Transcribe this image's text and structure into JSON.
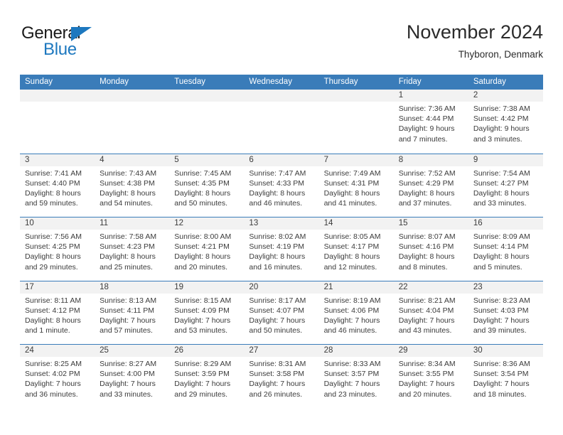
{
  "brand": {
    "name_part1": "General",
    "name_part2": "Blue",
    "triangle_color": "#1d78bf",
    "text_color": "#1a1a1a"
  },
  "header": {
    "title": "November 2024",
    "subtitle": "Thyboron, Denmark"
  },
  "theme": {
    "header_blue": "#3a7cb9",
    "date_strip_gray": "#f2f2f2",
    "text_color": "#3b3b3b",
    "background": "#ffffff"
  },
  "weekdays": [
    "Sunday",
    "Monday",
    "Tuesday",
    "Wednesday",
    "Thursday",
    "Friday",
    "Saturday"
  ],
  "weeks": [
    [
      {
        "blank": true
      },
      {
        "blank": true
      },
      {
        "blank": true
      },
      {
        "blank": true
      },
      {
        "blank": true
      },
      {
        "blank": false,
        "day": "1",
        "sunrise": "Sunrise: 7:36 AM",
        "sunset": "Sunset: 4:44 PM",
        "daylight1": "Daylight: 9 hours",
        "daylight2": "and 7 minutes."
      },
      {
        "blank": false,
        "day": "2",
        "sunrise": "Sunrise: 7:38 AM",
        "sunset": "Sunset: 4:42 PM",
        "daylight1": "Daylight: 9 hours",
        "daylight2": "and 3 minutes."
      }
    ],
    [
      {
        "blank": false,
        "day": "3",
        "sunrise": "Sunrise: 7:41 AM",
        "sunset": "Sunset: 4:40 PM",
        "daylight1": "Daylight: 8 hours",
        "daylight2": "and 59 minutes."
      },
      {
        "blank": false,
        "day": "4",
        "sunrise": "Sunrise: 7:43 AM",
        "sunset": "Sunset: 4:38 PM",
        "daylight1": "Daylight: 8 hours",
        "daylight2": "and 54 minutes."
      },
      {
        "blank": false,
        "day": "5",
        "sunrise": "Sunrise: 7:45 AM",
        "sunset": "Sunset: 4:35 PM",
        "daylight1": "Daylight: 8 hours",
        "daylight2": "and 50 minutes."
      },
      {
        "blank": false,
        "day": "6",
        "sunrise": "Sunrise: 7:47 AM",
        "sunset": "Sunset: 4:33 PM",
        "daylight1": "Daylight: 8 hours",
        "daylight2": "and 46 minutes."
      },
      {
        "blank": false,
        "day": "7",
        "sunrise": "Sunrise: 7:49 AM",
        "sunset": "Sunset: 4:31 PM",
        "daylight1": "Daylight: 8 hours",
        "daylight2": "and 41 minutes."
      },
      {
        "blank": false,
        "day": "8",
        "sunrise": "Sunrise: 7:52 AM",
        "sunset": "Sunset: 4:29 PM",
        "daylight1": "Daylight: 8 hours",
        "daylight2": "and 37 minutes."
      },
      {
        "blank": false,
        "day": "9",
        "sunrise": "Sunrise: 7:54 AM",
        "sunset": "Sunset: 4:27 PM",
        "daylight1": "Daylight: 8 hours",
        "daylight2": "and 33 minutes."
      }
    ],
    [
      {
        "blank": false,
        "day": "10",
        "sunrise": "Sunrise: 7:56 AM",
        "sunset": "Sunset: 4:25 PM",
        "daylight1": "Daylight: 8 hours",
        "daylight2": "and 29 minutes."
      },
      {
        "blank": false,
        "day": "11",
        "sunrise": "Sunrise: 7:58 AM",
        "sunset": "Sunset: 4:23 PM",
        "daylight1": "Daylight: 8 hours",
        "daylight2": "and 25 minutes."
      },
      {
        "blank": false,
        "day": "12",
        "sunrise": "Sunrise: 8:00 AM",
        "sunset": "Sunset: 4:21 PM",
        "daylight1": "Daylight: 8 hours",
        "daylight2": "and 20 minutes."
      },
      {
        "blank": false,
        "day": "13",
        "sunrise": "Sunrise: 8:02 AM",
        "sunset": "Sunset: 4:19 PM",
        "daylight1": "Daylight: 8 hours",
        "daylight2": "and 16 minutes."
      },
      {
        "blank": false,
        "day": "14",
        "sunrise": "Sunrise: 8:05 AM",
        "sunset": "Sunset: 4:17 PM",
        "daylight1": "Daylight: 8 hours",
        "daylight2": "and 12 minutes."
      },
      {
        "blank": false,
        "day": "15",
        "sunrise": "Sunrise: 8:07 AM",
        "sunset": "Sunset: 4:16 PM",
        "daylight1": "Daylight: 8 hours",
        "daylight2": "and 8 minutes."
      },
      {
        "blank": false,
        "day": "16",
        "sunrise": "Sunrise: 8:09 AM",
        "sunset": "Sunset: 4:14 PM",
        "daylight1": "Daylight: 8 hours",
        "daylight2": "and 5 minutes."
      }
    ],
    [
      {
        "blank": false,
        "day": "17",
        "sunrise": "Sunrise: 8:11 AM",
        "sunset": "Sunset: 4:12 PM",
        "daylight1": "Daylight: 8 hours",
        "daylight2": "and 1 minute."
      },
      {
        "blank": false,
        "day": "18",
        "sunrise": "Sunrise: 8:13 AM",
        "sunset": "Sunset: 4:11 PM",
        "daylight1": "Daylight: 7 hours",
        "daylight2": "and 57 minutes."
      },
      {
        "blank": false,
        "day": "19",
        "sunrise": "Sunrise: 8:15 AM",
        "sunset": "Sunset: 4:09 PM",
        "daylight1": "Daylight: 7 hours",
        "daylight2": "and 53 minutes."
      },
      {
        "blank": false,
        "day": "20",
        "sunrise": "Sunrise: 8:17 AM",
        "sunset": "Sunset: 4:07 PM",
        "daylight1": "Daylight: 7 hours",
        "daylight2": "and 50 minutes."
      },
      {
        "blank": false,
        "day": "21",
        "sunrise": "Sunrise: 8:19 AM",
        "sunset": "Sunset: 4:06 PM",
        "daylight1": "Daylight: 7 hours",
        "daylight2": "and 46 minutes."
      },
      {
        "blank": false,
        "day": "22",
        "sunrise": "Sunrise: 8:21 AM",
        "sunset": "Sunset: 4:04 PM",
        "daylight1": "Daylight: 7 hours",
        "daylight2": "and 43 minutes."
      },
      {
        "blank": false,
        "day": "23",
        "sunrise": "Sunrise: 8:23 AM",
        "sunset": "Sunset: 4:03 PM",
        "daylight1": "Daylight: 7 hours",
        "daylight2": "and 39 minutes."
      }
    ],
    [
      {
        "blank": false,
        "day": "24",
        "sunrise": "Sunrise: 8:25 AM",
        "sunset": "Sunset: 4:02 PM",
        "daylight1": "Daylight: 7 hours",
        "daylight2": "and 36 minutes."
      },
      {
        "blank": false,
        "day": "25",
        "sunrise": "Sunrise: 8:27 AM",
        "sunset": "Sunset: 4:00 PM",
        "daylight1": "Daylight: 7 hours",
        "daylight2": "and 33 minutes."
      },
      {
        "blank": false,
        "day": "26",
        "sunrise": "Sunrise: 8:29 AM",
        "sunset": "Sunset: 3:59 PM",
        "daylight1": "Daylight: 7 hours",
        "daylight2": "and 29 minutes."
      },
      {
        "blank": false,
        "day": "27",
        "sunrise": "Sunrise: 8:31 AM",
        "sunset": "Sunset: 3:58 PM",
        "daylight1": "Daylight: 7 hours",
        "daylight2": "and 26 minutes."
      },
      {
        "blank": false,
        "day": "28",
        "sunrise": "Sunrise: 8:33 AM",
        "sunset": "Sunset: 3:57 PM",
        "daylight1": "Daylight: 7 hours",
        "daylight2": "and 23 minutes."
      },
      {
        "blank": false,
        "day": "29",
        "sunrise": "Sunrise: 8:34 AM",
        "sunset": "Sunset: 3:55 PM",
        "daylight1": "Daylight: 7 hours",
        "daylight2": "and 20 minutes."
      },
      {
        "blank": false,
        "day": "30",
        "sunrise": "Sunrise: 8:36 AM",
        "sunset": "Sunset: 3:54 PM",
        "daylight1": "Daylight: 7 hours",
        "daylight2": "and 18 minutes."
      }
    ]
  ]
}
